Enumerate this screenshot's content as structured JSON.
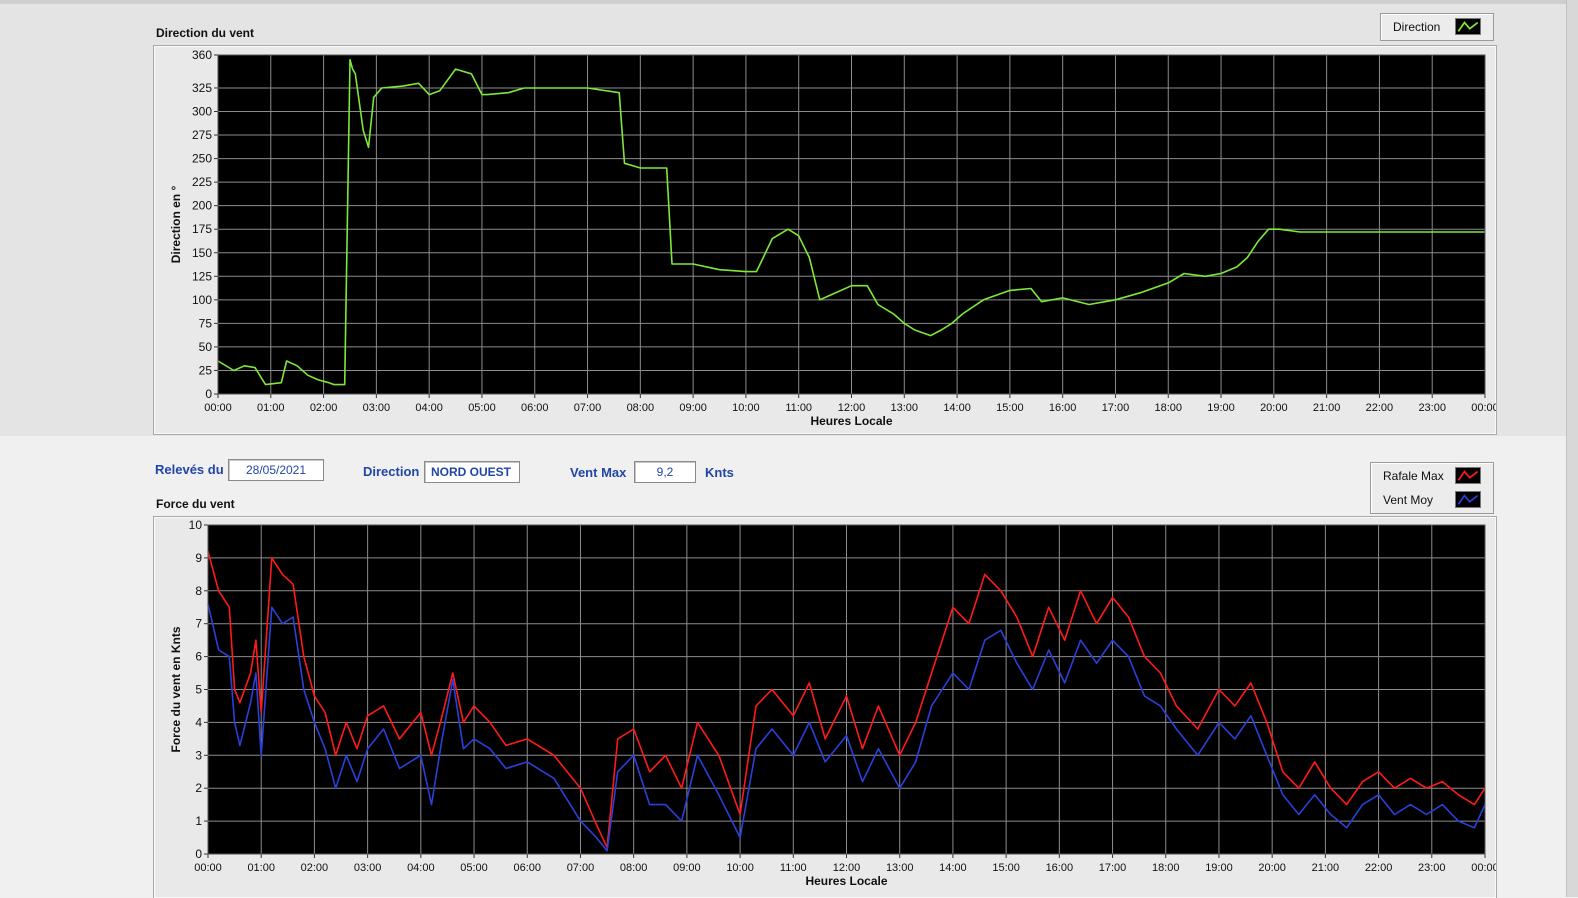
{
  "colors": {
    "direction": "#7ee83a",
    "rafale": "#ff1a1a",
    "vent_moy": "#2a40d8",
    "label_blue": "#2146a8"
  },
  "top_panel": {
    "title": "Direction du vent",
    "legend": {
      "label": "Direction"
    }
  },
  "info": {
    "releves_label": "Relevés du",
    "date": "28/05/2021",
    "direction_label": "Direction",
    "direction_value": "NORD OUEST",
    "ventmax_label": "Vent Max",
    "ventmax_value": "9,2",
    "unit": "Knts"
  },
  "bottom_panel": {
    "title": "Force du vent",
    "legend": [
      {
        "label": "Rafale Max"
      },
      {
        "label": "Vent Moy"
      }
    ]
  },
  "chart_data": [
    {
      "type": "line",
      "ylabel": "Direction en °",
      "xlabel": "Heures Locale",
      "x_ticks": [
        "00:00",
        "01:00",
        "02:00",
        "03:00",
        "04:00",
        "05:00",
        "06:00",
        "07:00",
        "08:00",
        "09:00",
        "10:00",
        "11:00",
        "12:00",
        "13:00",
        "14:00",
        "15:00",
        "16:00",
        "17:00",
        "18:00",
        "19:00",
        "20:00",
        "21:00",
        "22:00",
        "23:00",
        "00:00"
      ],
      "y_ticks": [
        0,
        25,
        50,
        75,
        100,
        125,
        150,
        175,
        200,
        225,
        250,
        275,
        300,
        325,
        360
      ],
      "ylim": [
        0,
        360
      ],
      "xlim_hours": [
        0,
        24
      ],
      "grid": true,
      "series": [
        {
          "name": "Direction",
          "x_hours": [
            0,
            0.3,
            0.5,
            0.7,
            0.9,
            1.2,
            1.3,
            1.5,
            1.7,
            1.9,
            2.1,
            2.2,
            2.4,
            2.5,
            2.55,
            2.6,
            2.75,
            2.85,
            2.95,
            3.1,
            3.5,
            3.8,
            4.0,
            4.2,
            4.5,
            4.8,
            5.0,
            5.1,
            5.5,
            5.8,
            6.5,
            7.0,
            7.6,
            7.7,
            8.0,
            8.5,
            8.6,
            9.0,
            9.5,
            10.0,
            10.2,
            10.5,
            10.8,
            11.0,
            11.2,
            11.4,
            11.6,
            12.0,
            12.3,
            12.5,
            12.8,
            13.0,
            13.2,
            13.5,
            13.7,
            13.9,
            14.1,
            14.5,
            15.0,
            15.4,
            15.6,
            16.0,
            16.5,
            17.0,
            17.5,
            18.0,
            18.3,
            18.7,
            19.0,
            19.3,
            19.5,
            19.7,
            19.9,
            20.1,
            20.5,
            24.0
          ],
          "y_deg": [
            35,
            25,
            30,
            28,
            10,
            12,
            35,
            30,
            20,
            15,
            12,
            10,
            10,
            355,
            345,
            340,
            280,
            262,
            315,
            325,
            327,
            330,
            318,
            322,
            345,
            340,
            318,
            318,
            320,
            325,
            325,
            325,
            320,
            245,
            240,
            240,
            138,
            138,
            132,
            130,
            130,
            165,
            175,
            168,
            145,
            100,
            105,
            115,
            115,
            95,
            85,
            75,
            68,
            62,
            68,
            75,
            85,
            100,
            110,
            112,
            98,
            102,
            95,
            100,
            108,
            118,
            128,
            125,
            128,
            135,
            145,
            162,
            175,
            175,
            172,
            172
          ]
        }
      ]
    },
    {
      "type": "line",
      "ylabel": "Force du vent en Knts",
      "xlabel": "Heures Locale",
      "x_ticks": [
        "00:00",
        "01:00",
        "02:00",
        "03:00",
        "04:00",
        "05:00",
        "06:00",
        "07:00",
        "08:00",
        "09:00",
        "10:00",
        "11:00",
        "12:00",
        "13:00",
        "14:00",
        "15:00",
        "16:00",
        "17:00",
        "18:00",
        "19:00",
        "20:00",
        "21:00",
        "22:00",
        "23:00",
        "00:00"
      ],
      "y_ticks": [
        0,
        1,
        2,
        3,
        4,
        5,
        6,
        7,
        8,
        9,
        10
      ],
      "ylim": [
        0,
        10
      ],
      "xlim_hours": [
        0,
        24
      ],
      "grid": true,
      "series": [
        {
          "name": "Rafale Max",
          "x_hours": [
            0,
            0.2,
            0.4,
            0.5,
            0.6,
            0.8,
            0.9,
            1.0,
            1.2,
            1.4,
            1.6,
            1.8,
            2.0,
            2.2,
            2.4,
            2.6,
            2.8,
            3.0,
            3.3,
            3.6,
            4.0,
            4.2,
            4.4,
            4.6,
            4.8,
            5.0,
            5.3,
            5.6,
            6.0,
            6.5,
            7.0,
            7.3,
            7.5,
            7.7,
            8.0,
            8.3,
            8.6,
            8.9,
            9.2,
            9.6,
            10.0,
            10.3,
            10.6,
            11.0,
            11.3,
            11.6,
            12.0,
            12.3,
            12.6,
            13.0,
            13.3,
            13.6,
            14.0,
            14.3,
            14.6,
            14.9,
            15.2,
            15.5,
            15.8,
            16.1,
            16.4,
            16.7,
            17.0,
            17.3,
            17.6,
            17.9,
            18.2,
            18.6,
            19.0,
            19.3,
            19.6,
            19.9,
            20.2,
            20.5,
            20.8,
            21.1,
            21.4,
            21.7,
            22.0,
            22.3,
            22.6,
            22.9,
            23.2,
            23.5,
            23.8,
            24.0
          ],
          "y": [
            9.2,
            8.0,
            7.5,
            5.0,
            4.6,
            5.5,
            6.5,
            4.3,
            9.0,
            8.5,
            8.2,
            6.0,
            4.8,
            4.3,
            3.0,
            4.0,
            3.2,
            4.2,
            4.5,
            3.5,
            4.3,
            3.0,
            4.2,
            5.5,
            4.0,
            4.5,
            4.0,
            3.3,
            3.5,
            3.0,
            2.0,
            0.9,
            0.2,
            3.5,
            3.8,
            2.5,
            3.0,
            2.0,
            4.0,
            3.0,
            1.2,
            4.5,
            5.0,
            4.2,
            5.2,
            3.5,
            4.8,
            3.2,
            4.5,
            3.0,
            4.0,
            5.5,
            7.5,
            7.0,
            8.5,
            8.0,
            7.2,
            6.0,
            7.5,
            6.5,
            8.0,
            7.0,
            7.8,
            7.2,
            6.0,
            5.5,
            4.5,
            3.8,
            5.0,
            4.5,
            5.2,
            4.0,
            2.5,
            2.0,
            2.8,
            2.0,
            1.5,
            2.2,
            2.5,
            2.0,
            2.3,
            2.0,
            2.2,
            1.8,
            1.5,
            2.0
          ]
        },
        {
          "name": "Vent Moy",
          "x_hours": [
            0,
            0.2,
            0.4,
            0.5,
            0.6,
            0.8,
            0.9,
            1.0,
            1.2,
            1.4,
            1.6,
            1.8,
            2.0,
            2.2,
            2.4,
            2.6,
            2.8,
            3.0,
            3.3,
            3.6,
            4.0,
            4.2,
            4.4,
            4.6,
            4.8,
            5.0,
            5.3,
            5.6,
            6.0,
            6.5,
            7.0,
            7.3,
            7.5,
            7.7,
            8.0,
            8.3,
            8.6,
            8.9,
            9.2,
            9.6,
            10.0,
            10.3,
            10.6,
            11.0,
            11.3,
            11.6,
            12.0,
            12.3,
            12.6,
            13.0,
            13.3,
            13.6,
            14.0,
            14.3,
            14.6,
            14.9,
            15.2,
            15.5,
            15.8,
            16.1,
            16.4,
            16.7,
            17.0,
            17.3,
            17.6,
            17.9,
            18.2,
            18.6,
            19.0,
            19.3,
            19.6,
            19.9,
            20.2,
            20.5,
            20.8,
            21.1,
            21.4,
            21.7,
            22.0,
            22.3,
            22.6,
            22.9,
            23.2,
            23.5,
            23.8,
            24.0
          ],
          "y": [
            7.6,
            6.2,
            6.0,
            4.0,
            3.3,
            4.6,
            5.5,
            3.0,
            7.5,
            7.0,
            7.2,
            5.0,
            4.0,
            3.2,
            2.0,
            3.0,
            2.2,
            3.2,
            3.8,
            2.6,
            3.0,
            1.5,
            3.5,
            5.3,
            3.2,
            3.5,
            3.2,
            2.6,
            2.8,
            2.3,
            1.0,
            0.5,
            0.1,
            2.5,
            3.0,
            1.5,
            1.5,
            1.0,
            3.0,
            1.8,
            0.5,
            3.2,
            3.8,
            3.0,
            4.0,
            2.8,
            3.6,
            2.2,
            3.2,
            2.0,
            2.8,
            4.5,
            5.5,
            5.0,
            6.5,
            6.8,
            5.8,
            5.0,
            6.2,
            5.2,
            6.5,
            5.8,
            6.5,
            6.0,
            4.8,
            4.5,
            3.8,
            3.0,
            4.0,
            3.5,
            4.2,
            3.0,
            1.8,
            1.2,
            1.8,
            1.2,
            0.8,
            1.5,
            1.8,
            1.2,
            1.5,
            1.2,
            1.5,
            1.0,
            0.8,
            1.5
          ]
        }
      ]
    }
  ]
}
